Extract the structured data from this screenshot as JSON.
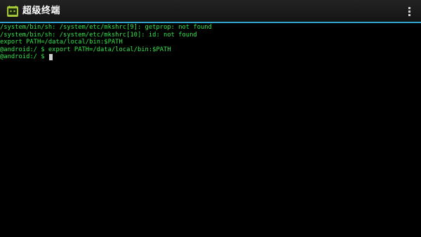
{
  "app": {
    "title": "超级终端",
    "icon": "android-terminal-icon",
    "accent_color": "#2fa6cf"
  },
  "action_bar": {
    "overflow_icon": "overflow-menu-icon"
  },
  "terminal": {
    "text_color": "#33e54a",
    "background_color": "#000000",
    "lines": [
      "/system/bin/sh: /system/etc/mkshrc[9]: getprop: not found",
      "/system/bin/sh: /system/etc/mkshrc[10]: id: not found",
      "export PATH=/data/local/bin:$PATH",
      "@android:/ $ export PATH=/data/local/bin:$PATH"
    ],
    "current_prompt": "@android:/ $ "
  }
}
